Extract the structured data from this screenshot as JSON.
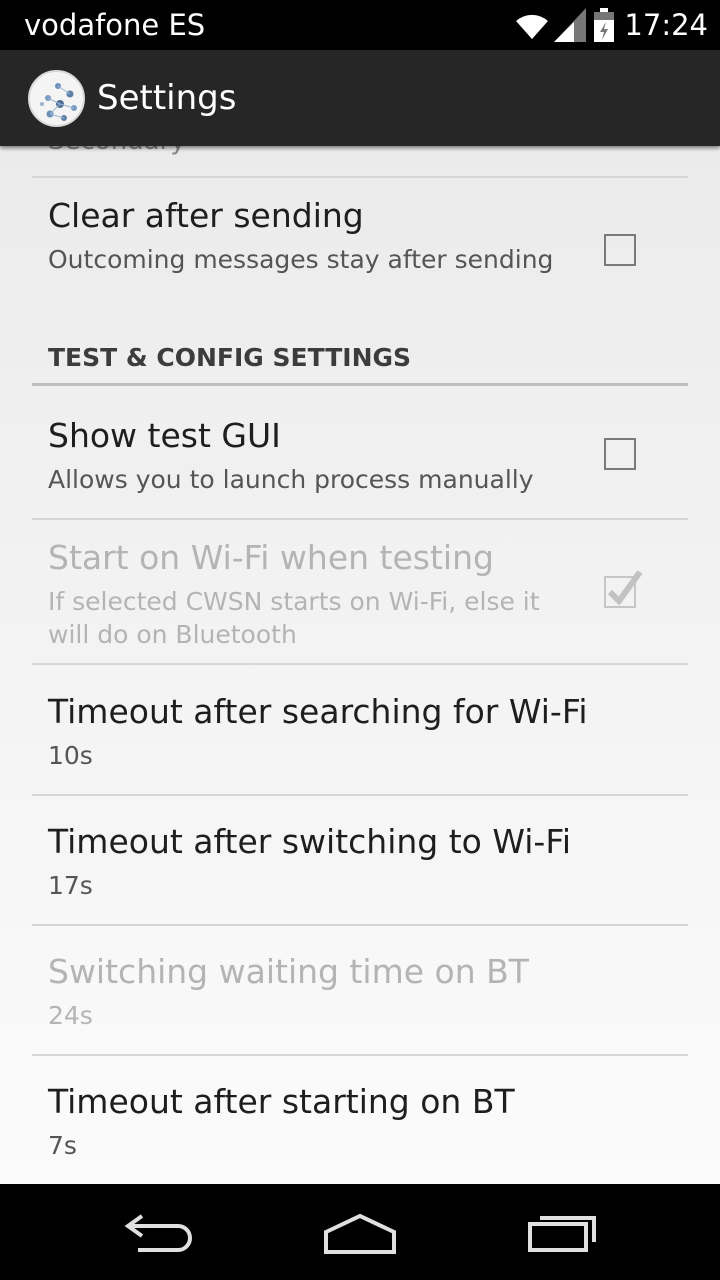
{
  "status_bar": {
    "carrier": "vodafone ES",
    "time": "17:24",
    "icons": [
      "wifi-icon",
      "signal-icon",
      "battery-icon"
    ]
  },
  "action_bar": {
    "title": "Settings",
    "icon": "app-logo-icon"
  },
  "clipped_item_summary": "Secondary",
  "preferences": {
    "clear_after_sending": {
      "title": "Clear after sending",
      "summary": "Outcoming messages stay after sending",
      "checked": false
    },
    "section_header": "TEST & CONFIG SETTINGS",
    "show_test_gui": {
      "title": "Show test GUI",
      "summary": "Allows you to launch process manually",
      "checked": false
    },
    "start_on_wifi": {
      "title": "Start on Wi-Fi when testing",
      "summary": "If selected CWSN starts on Wi-Fi, else it will do on Bluetooth",
      "checked": true,
      "enabled": false
    },
    "timeout_searching_wifi": {
      "title": "Timeout after searching for Wi-Fi",
      "summary": "10s"
    },
    "timeout_switching_wifi": {
      "title": "Timeout after switching to Wi-Fi",
      "summary": "17s"
    },
    "switching_waiting_bt": {
      "title": "Switching waiting time on BT",
      "summary": "24s",
      "enabled": false
    },
    "timeout_starting_bt": {
      "title": "Timeout after starting on BT",
      "summary": "7s"
    }
  },
  "nav_bar": {
    "buttons": [
      "back-icon",
      "home-icon",
      "recent-apps-icon"
    ]
  },
  "colors": {
    "action_bar": "#262626",
    "background": "#ebebeb",
    "disabled_text": "#b4b4b4"
  }
}
